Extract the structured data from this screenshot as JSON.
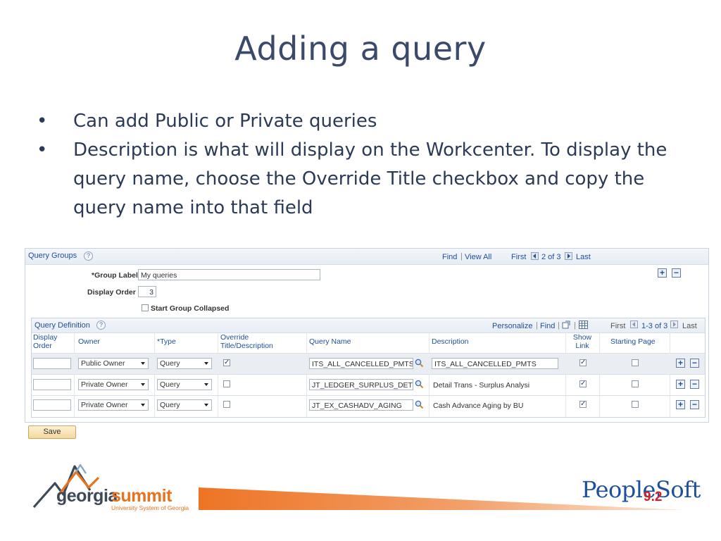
{
  "slide": {
    "title": "Adding a query",
    "bullets": [
      "Can add Public or Private queries",
      "Description is what will display on the Workcenter.  To display the query name, choose the Override Title checkbox and copy the query name into that field"
    ],
    "bullet_glyph": "•"
  },
  "query_groups": {
    "label": "Query Groups",
    "help": "?",
    "find": "Find",
    "view_all": "View All",
    "first": "First",
    "pager": "2 of 3",
    "last": "Last",
    "group_label_caption": "*Group Label",
    "group_label_value": "My queries",
    "display_order_caption": "Display Order",
    "display_order_value": "3",
    "start_collapsed_caption": "Start Group Collapsed",
    "start_collapsed_checked": false
  },
  "query_definition": {
    "label": "Query Definition",
    "help": "?",
    "personalize": "Personalize",
    "find": "Find",
    "first": "First",
    "pager": "1-3 of 3",
    "last": "Last",
    "columns": {
      "display_order": "Display Order",
      "owner": "Owner",
      "type": "*Type",
      "override": "Override Title/Description",
      "query_name": "Query Name",
      "description": "Description",
      "show_link": "Show Link",
      "starting_page": "Starting Page"
    },
    "rows": [
      {
        "display_order": "",
        "owner": "Public Owner",
        "type": "Query",
        "override": true,
        "query_name": "ITS_ALL_CANCELLED_PMTS",
        "description": "ITS_ALL_CANCELLED_PMTS",
        "description_editable": true,
        "show_link": true,
        "starting_page": false
      },
      {
        "display_order": "",
        "owner": "Private Owner",
        "type": "Query",
        "override": false,
        "query_name": "JT_LEDGER_SURPLUS_DET",
        "description": "Detail Trans - Surplus Analysi",
        "description_editable": false,
        "show_link": true,
        "starting_page": false
      },
      {
        "display_order": "",
        "owner": "Private Owner",
        "type": "Query",
        "override": false,
        "query_name": "JT_EX_CASHADV_AGING",
        "description": "Cash Advance Aging by BU",
        "description_editable": false,
        "show_link": true,
        "starting_page": false
      }
    ]
  },
  "save_label": "Save",
  "footer": {
    "georgia": "georgia",
    "summit": "summit",
    "usg": "University System of Georgia",
    "peoplesoft": "PeopleSoft",
    "version": "9.2"
  }
}
